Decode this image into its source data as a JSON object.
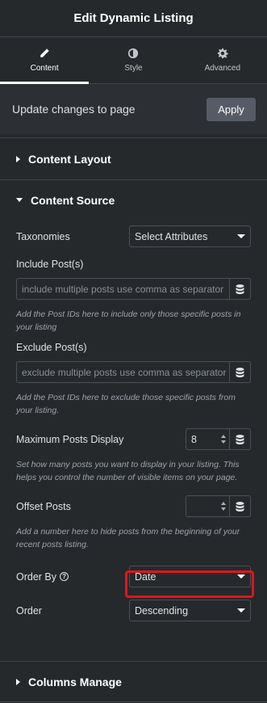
{
  "header": {
    "title": "Edit Dynamic Listing"
  },
  "tabs": [
    {
      "label": "Content",
      "icon": "pencil-icon",
      "active": true
    },
    {
      "label": "Style",
      "icon": "contrast-icon",
      "active": false
    },
    {
      "label": "Advanced",
      "icon": "gear-icon",
      "active": false
    }
  ],
  "update": {
    "text": "Update changes to page",
    "button": "Apply"
  },
  "sections": {
    "layout": "Content Layout",
    "source": "Content Source",
    "columns": "Columns Manage"
  },
  "fields": {
    "taxonomies": {
      "label": "Taxonomies",
      "value": "Select Attributes"
    },
    "include": {
      "label": "Include Post(s)",
      "placeholder": "include multiple posts use comma as separator",
      "help": "Add the Post IDs here to include only those specific posts in your listing"
    },
    "exclude": {
      "label": "Exclude Post(s)",
      "placeholder": "exclude multiple posts use comma as separator",
      "help": "Add the Post IDs here to exclude those specific posts from your listing."
    },
    "max_posts": {
      "label": "Maximum Posts Display",
      "value": "8",
      "help": "Set how many posts you want to display in your listing. This helps you control the number of visible items on your page."
    },
    "offset": {
      "label": "Offset Posts",
      "value": "",
      "help": "Add a number here to hide posts from the beginning of your recent posts listing."
    },
    "order_by": {
      "label": "Order By",
      "value": "Date"
    },
    "order": {
      "label": "Order",
      "value": "Descending"
    }
  },
  "colors": {
    "background": "#26292c",
    "highlight": "#e0151b",
    "apply_bg": "#555c65"
  }
}
